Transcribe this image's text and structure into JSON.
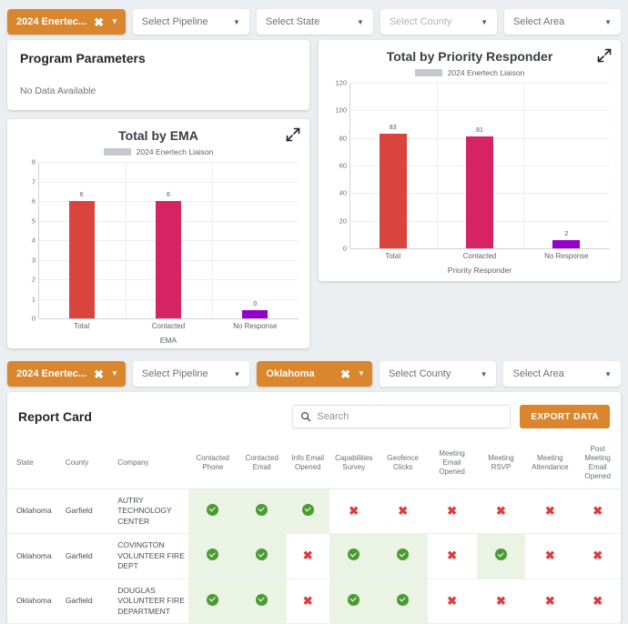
{
  "filters_top": {
    "program_chip": "2024 Enertec...",
    "pipeline": "Select Pipeline",
    "state": "Select State",
    "county": "Select County",
    "area": "Select Area"
  },
  "filters_bottom": {
    "program_chip": "2024 Enertec...",
    "pipeline": "Select Pipeline",
    "state_chip": "Oklahoma",
    "county": "Select County",
    "area": "Select Area"
  },
  "program_parameters": {
    "title": "Program Parameters",
    "empty_text": "No Data Available"
  },
  "report_card": {
    "title": "Report Card",
    "search_placeholder": "Search",
    "export_label": "EXPORT DATA",
    "columns": [
      "State",
      "County",
      "Company",
      "Contacted Phone",
      "Contacted Email",
      "Info Email Opened",
      "Capabilities Survey",
      "Geofence Clicks",
      "Meeting Email Opened",
      "Meeting RSVP",
      "Meeting Attendance",
      "Post Meeting Email Opened"
    ],
    "rows": [
      {
        "state": "Oklahoma",
        "county": "Garfield",
        "company": "AUTRY TECHNOLOGY CENTER",
        "flags": [
          true,
          true,
          true,
          false,
          false,
          false,
          false,
          false,
          false
        ]
      },
      {
        "state": "Oklahoma",
        "county": "Garfield",
        "company": "COVINGTON VOLUNTEER FIRE DEPT",
        "flags": [
          true,
          true,
          false,
          true,
          true,
          false,
          true,
          false,
          false
        ]
      },
      {
        "state": "Oklahoma",
        "county": "Garfield",
        "company": "DOUGLAS VOLUNTEER FIRE DEPARTMENT",
        "flags": [
          true,
          true,
          false,
          true,
          true,
          false,
          false,
          false,
          false
        ]
      }
    ]
  },
  "colors": {
    "accent_orange": "#d9862e",
    "bar_red": "#d9453c",
    "bar_magenta": "#d62463",
    "bar_purple": "#9400c8",
    "check_green": "#4a9b31",
    "cross_red": "#e03b3b"
  },
  "chart_data": [
    {
      "id": "ema",
      "type": "bar",
      "title": "Total by EMA",
      "legend": [
        "2024 Enertech Liaison"
      ],
      "legend_position": "top-center",
      "categories": [
        "Total",
        "Contacted",
        "No Response"
      ],
      "values": [
        6,
        6,
        0
      ],
      "colors": [
        "#d9453c",
        "#d62463",
        "#9400c8"
      ],
      "xlabel": "EMA",
      "ylabel": "",
      "ylim": [
        0,
        8
      ],
      "yticks": [
        0,
        1,
        2,
        3,
        4,
        5,
        6,
        7,
        8
      ],
      "grid": true,
      "data_labels": [
        "6",
        "6",
        "0"
      ]
    },
    {
      "id": "priority-responder",
      "type": "bar",
      "title": "Total by Priority Responder",
      "legend": [
        "2024 Enertech Liaison"
      ],
      "legend_position": "top-center",
      "categories": [
        "Total",
        "Contacted",
        "No Response"
      ],
      "values": [
        83,
        81,
        2
      ],
      "colors": [
        "#d9453c",
        "#d62463",
        "#9400c8"
      ],
      "xlabel": "Priority Responder",
      "ylabel": "",
      "ylim": [
        0,
        120
      ],
      "yticks": [
        0,
        20,
        40,
        60,
        80,
        100,
        120
      ],
      "grid": true,
      "data_labels": [
        "83",
        "81",
        "2"
      ]
    }
  ]
}
